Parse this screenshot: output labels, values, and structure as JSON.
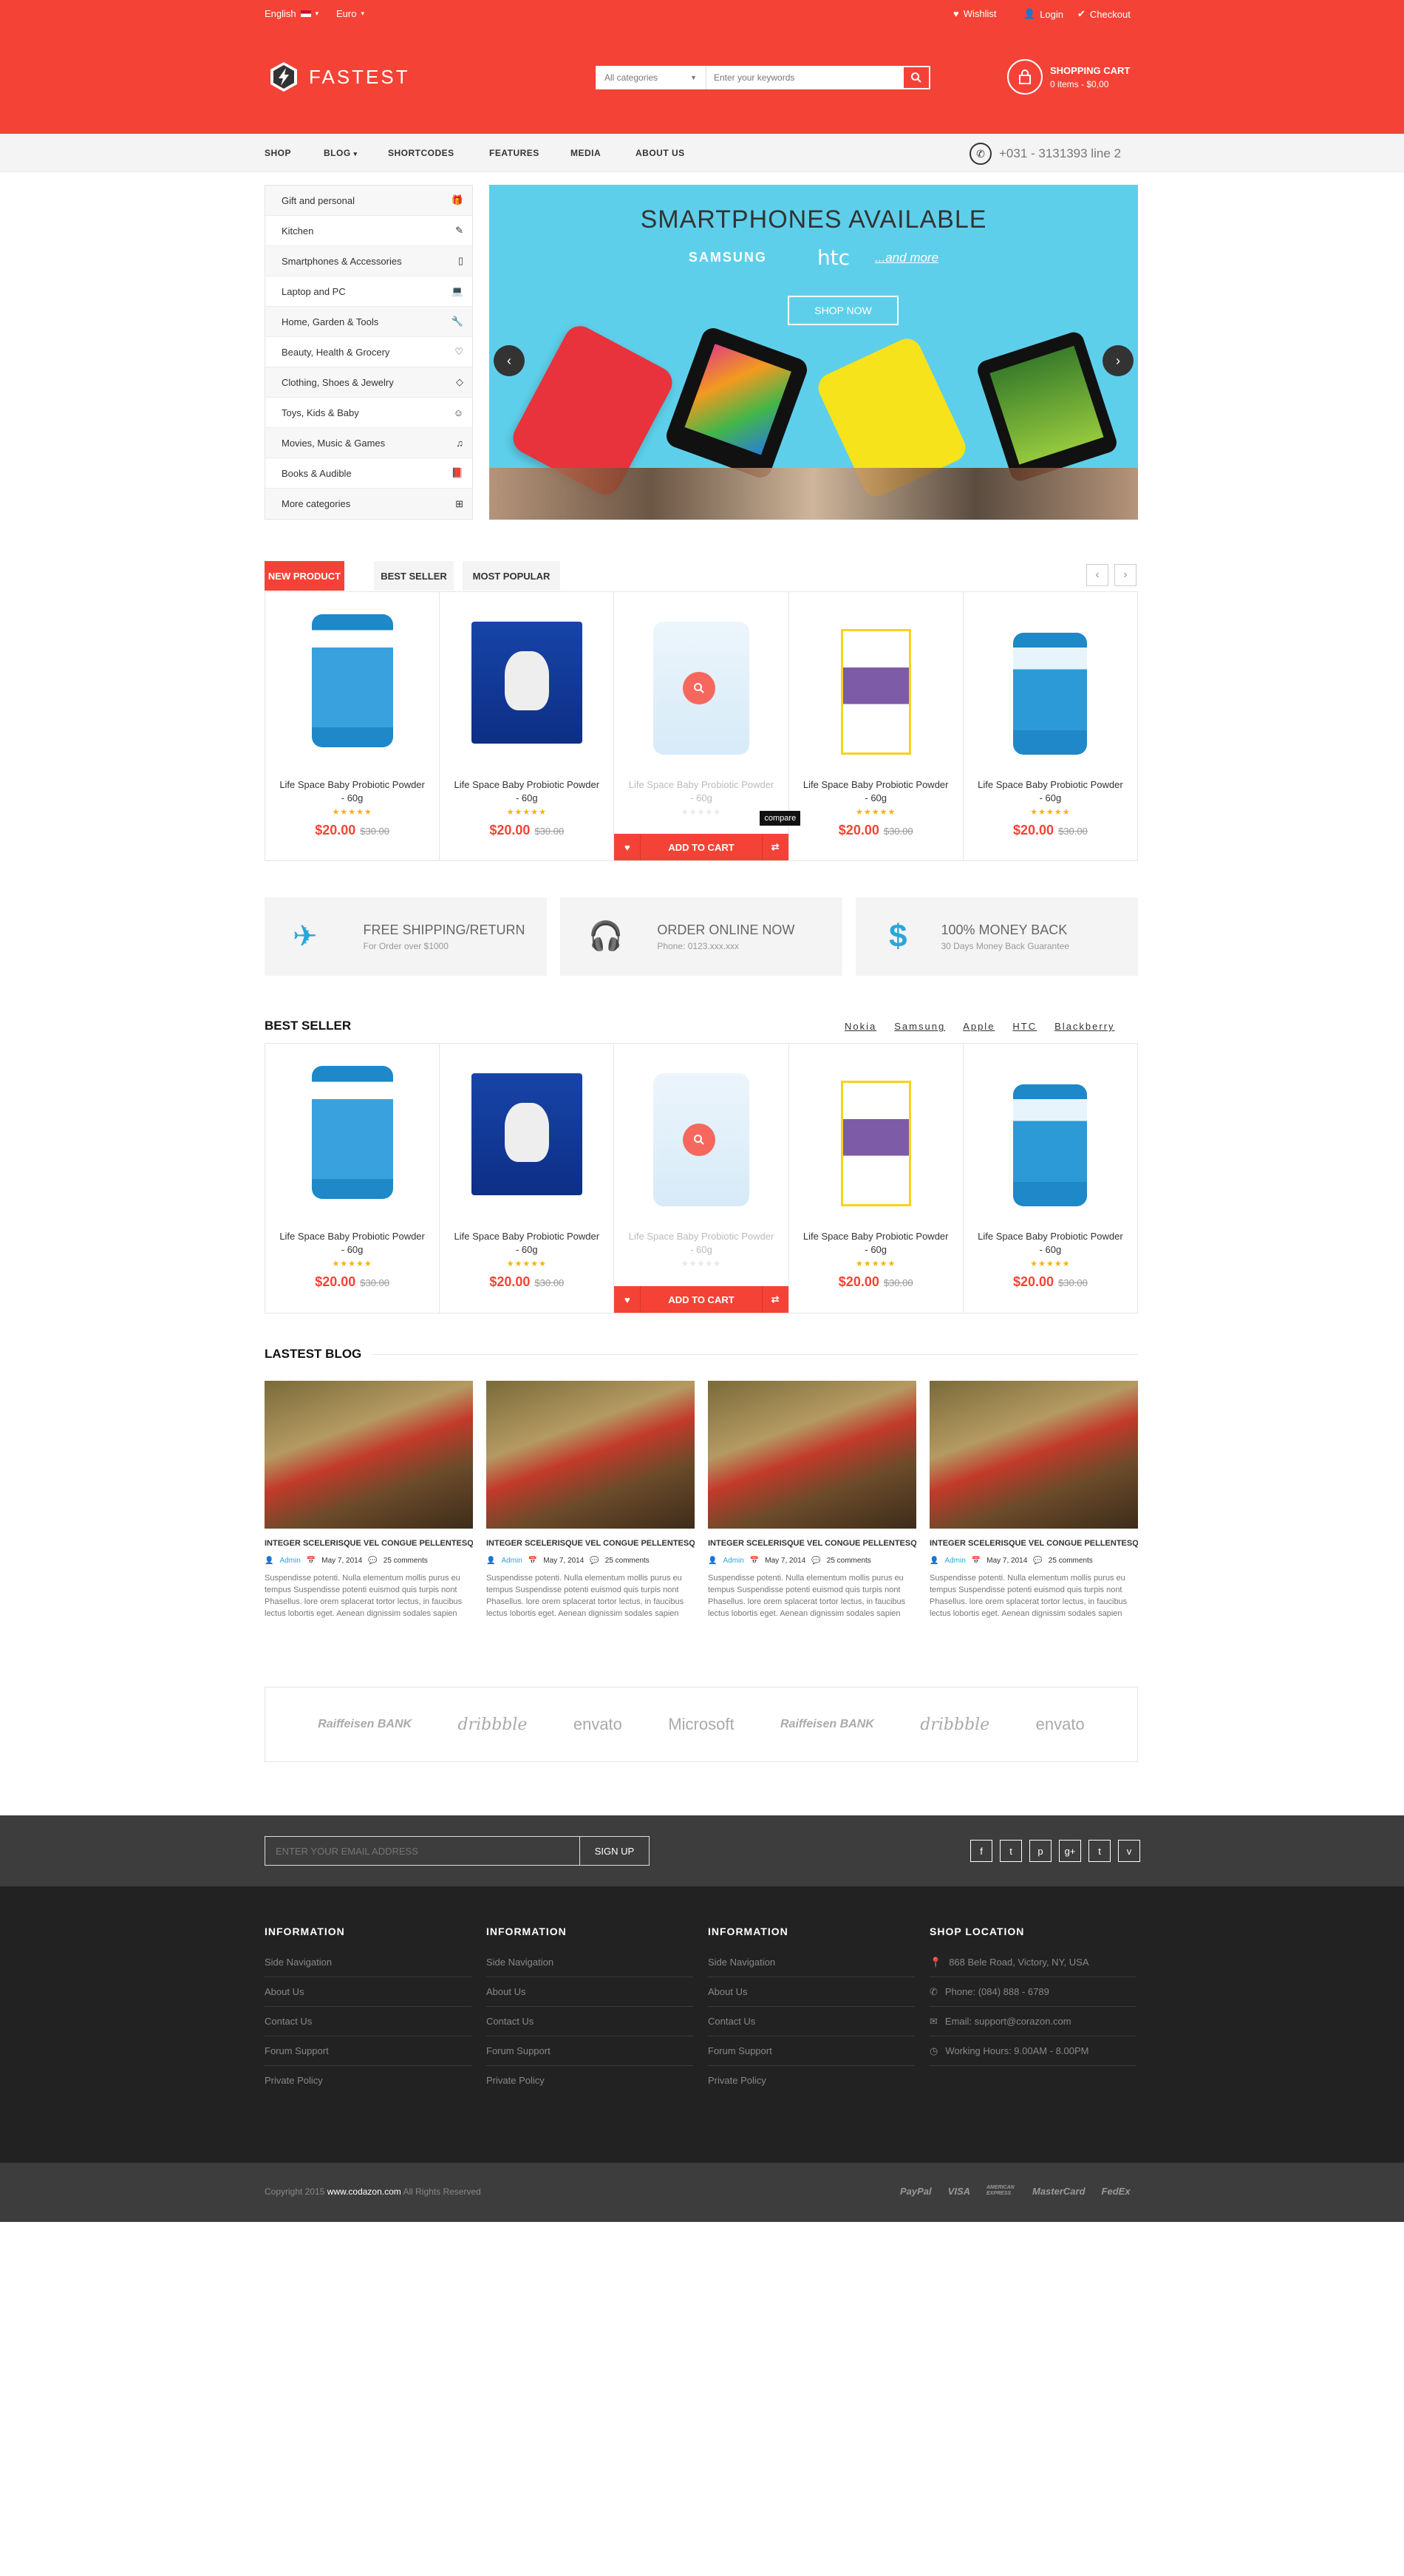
{
  "topbar": {
    "language": "English",
    "currency": "Euro",
    "wishlist": "Wishlist",
    "login": "Login",
    "checkout": "Checkout"
  },
  "header": {
    "logo": "FASTEST",
    "search_category": "All categories",
    "search_placeholder": "Enter your keywords",
    "cart_title": "SHOPPING CART",
    "cart_summary": "0 items - $0,00"
  },
  "nav": {
    "items": [
      "SHOP",
      "BLOG",
      "SHORTCODES",
      "FEATURES",
      "MEDIA",
      "ABOUT US"
    ],
    "phone": "+031 - 3131393 line 2"
  },
  "sidebar": {
    "categories": [
      "Gift and personal",
      "Kitchen",
      "Smartphones & Accessories",
      "Laptop and PC",
      "Home, Garden & Tools",
      "Beauty, Health & Grocery",
      "Clothing, Shoes & Jewelry",
      "Toys, Kids & Baby",
      "Movies, Music & Games",
      "Books & Audible",
      "More categories"
    ]
  },
  "banner": {
    "title": "SMARTPHONES AVAILABLE",
    "brands": [
      "SAMSUNG",
      "htc",
      "...and more"
    ],
    "button": "SHOP NOW"
  },
  "tabs": [
    "NEW PRODUCT",
    "BEST SELLER",
    "MOST POPULAR"
  ],
  "products": [
    {
      "name": "Life Space Baby Probiotic Powder - 60g",
      "price": "$20.00",
      "old_price": "$30.00",
      "stars": "★★★★★"
    },
    {
      "name": "Life Space Baby Probiotic Powder - 60g",
      "price": "$20.00",
      "old_price": "$30.00",
      "stars": "★★★★★"
    },
    {
      "name": "Life Space Baby Probiotic Powder - 60g",
      "price": "",
      "old_price": "",
      "stars": "★★★★★"
    },
    {
      "name": "Life Space Baby Probiotic Powder - 60g",
      "price": "$20.00",
      "old_price": "$30.00",
      "stars": "★★★★★"
    },
    {
      "name": "Life Space Baby Probiotic Powder - 60g",
      "price": "$20.00",
      "old_price": "$30.00",
      "stars": "★★★★★"
    }
  ],
  "add_to_cart": "ADD TO CART",
  "compare_tooltip": "compare",
  "services": [
    {
      "title": "FREE SHIPPING/RETURN",
      "sub": "For Order over $1000"
    },
    {
      "title": "ORDER ONLINE NOW",
      "sub": "Phone: 0123.xxx.xxx"
    },
    {
      "title": "100% MONEY BACK",
      "sub": "30 Days Money Back Guarantee"
    }
  ],
  "best_seller": {
    "title": "BEST SELLER",
    "brands": [
      "Nokia",
      "Samsung",
      "Apple",
      "HTC",
      "Blackberry"
    ]
  },
  "blog": {
    "title": "LASTEST BLOG",
    "posts": [
      {
        "title": "INTEGER SCELERISQUE VEL CONGUE PELLENTESQUE...",
        "author": "Admin",
        "date": "May 7, 2014",
        "comments": "25 comments",
        "excerpt": "Suspendisse potenti. Nulla elementum mollis purus eu tempus Suspendisse potenti euismod quis turpis nont Phasellus. lore orem splacerat tortor lectus, in faucibus lectus lobortis eget. Aenean dignissim sodales sapien"
      },
      {
        "title": "INTEGER SCELERISQUE VEL CONGUE PELLENTESQUE...",
        "author": "Admin",
        "date": "May 7, 2014",
        "comments": "25 comments",
        "excerpt": "Suspendisse potenti. Nulla elementum mollis purus eu tempus Suspendisse potenti euismod quis turpis nont Phasellus. lore orem splacerat tortor lectus, in faucibus lectus lobortis eget. Aenean dignissim sodales sapien"
      },
      {
        "title": "INTEGER SCELERISQUE VEL CONGUE PELLENTESQUE...",
        "author": "Admin",
        "date": "May 7, 2014",
        "comments": "25 comments",
        "excerpt": "Suspendisse potenti. Nulla elementum mollis purus eu tempus Suspendisse potenti euismod quis turpis nont Phasellus. lore orem splacerat tortor lectus, in faucibus lectus lobortis eget. Aenean dignissim sodales sapien"
      },
      {
        "title": "INTEGER SCELERISQUE VEL CONGUE PELLENTESQUE...",
        "author": "Admin",
        "date": "May 7, 2014",
        "comments": "25 comments",
        "excerpt": "Suspendisse potenti. Nulla elementum mollis purus eu tempus Suspendisse potenti euismod quis turpis nont Phasellus. lore orem splacerat tortor lectus, in faucibus lectus lobortis eget. Aenean dignissim sodales sapien"
      }
    ]
  },
  "partners": [
    "Raiffeisen BANK",
    "dribbble",
    "envato",
    "Microsoft",
    "Raiffeisen BANK",
    "dribbble",
    "envato"
  ],
  "newsletter": {
    "placeholder": "ENTER YOUR EMAIL ADDRESS",
    "button": "SIGN UP"
  },
  "social": [
    "f",
    "t",
    "p",
    "g+",
    "t",
    "v"
  ],
  "footer": {
    "columns": [
      {
        "title": "INFORMATION",
        "links": [
          "Side Navigation",
          "About Us",
          "Contact Us",
          "Forum Support",
          "Private Policy"
        ]
      },
      {
        "title": "INFORMATION",
        "links": [
          "Side Navigation",
          "About Us",
          "Contact Us",
          "Forum Support",
          "Private Policy"
        ]
      },
      {
        "title": "INFORMATION",
        "links": [
          "Side Navigation",
          "About Us",
          "Contact Us",
          "Forum Support",
          "Private Policy"
        ]
      }
    ],
    "location": {
      "title": "SHOP LOCATION",
      "address": "868 Bele Road, Victory, NY, USA",
      "phone": "Phone: (084) 888 - 6789",
      "email": "Email: support@corazon.com",
      "hours": "Working Hours: 9.00AM - 8.00PM"
    },
    "copyright_pre": "Copyright 2015",
    "copyright_link": "www.codazon.com",
    "copyright_post": "All Rights Reserved",
    "payments": [
      "PayPal",
      "VISA",
      "AMERICAN EXPRESS",
      "MasterCard",
      "FedEx"
    ]
  },
  "colors": {
    "accent": "#f44336",
    "banner_bg": "#5ecfea",
    "footer_dark": "#222222",
    "newsletter_bg": "#3d3d3d",
    "service_icon": "#2aa6d9"
  }
}
